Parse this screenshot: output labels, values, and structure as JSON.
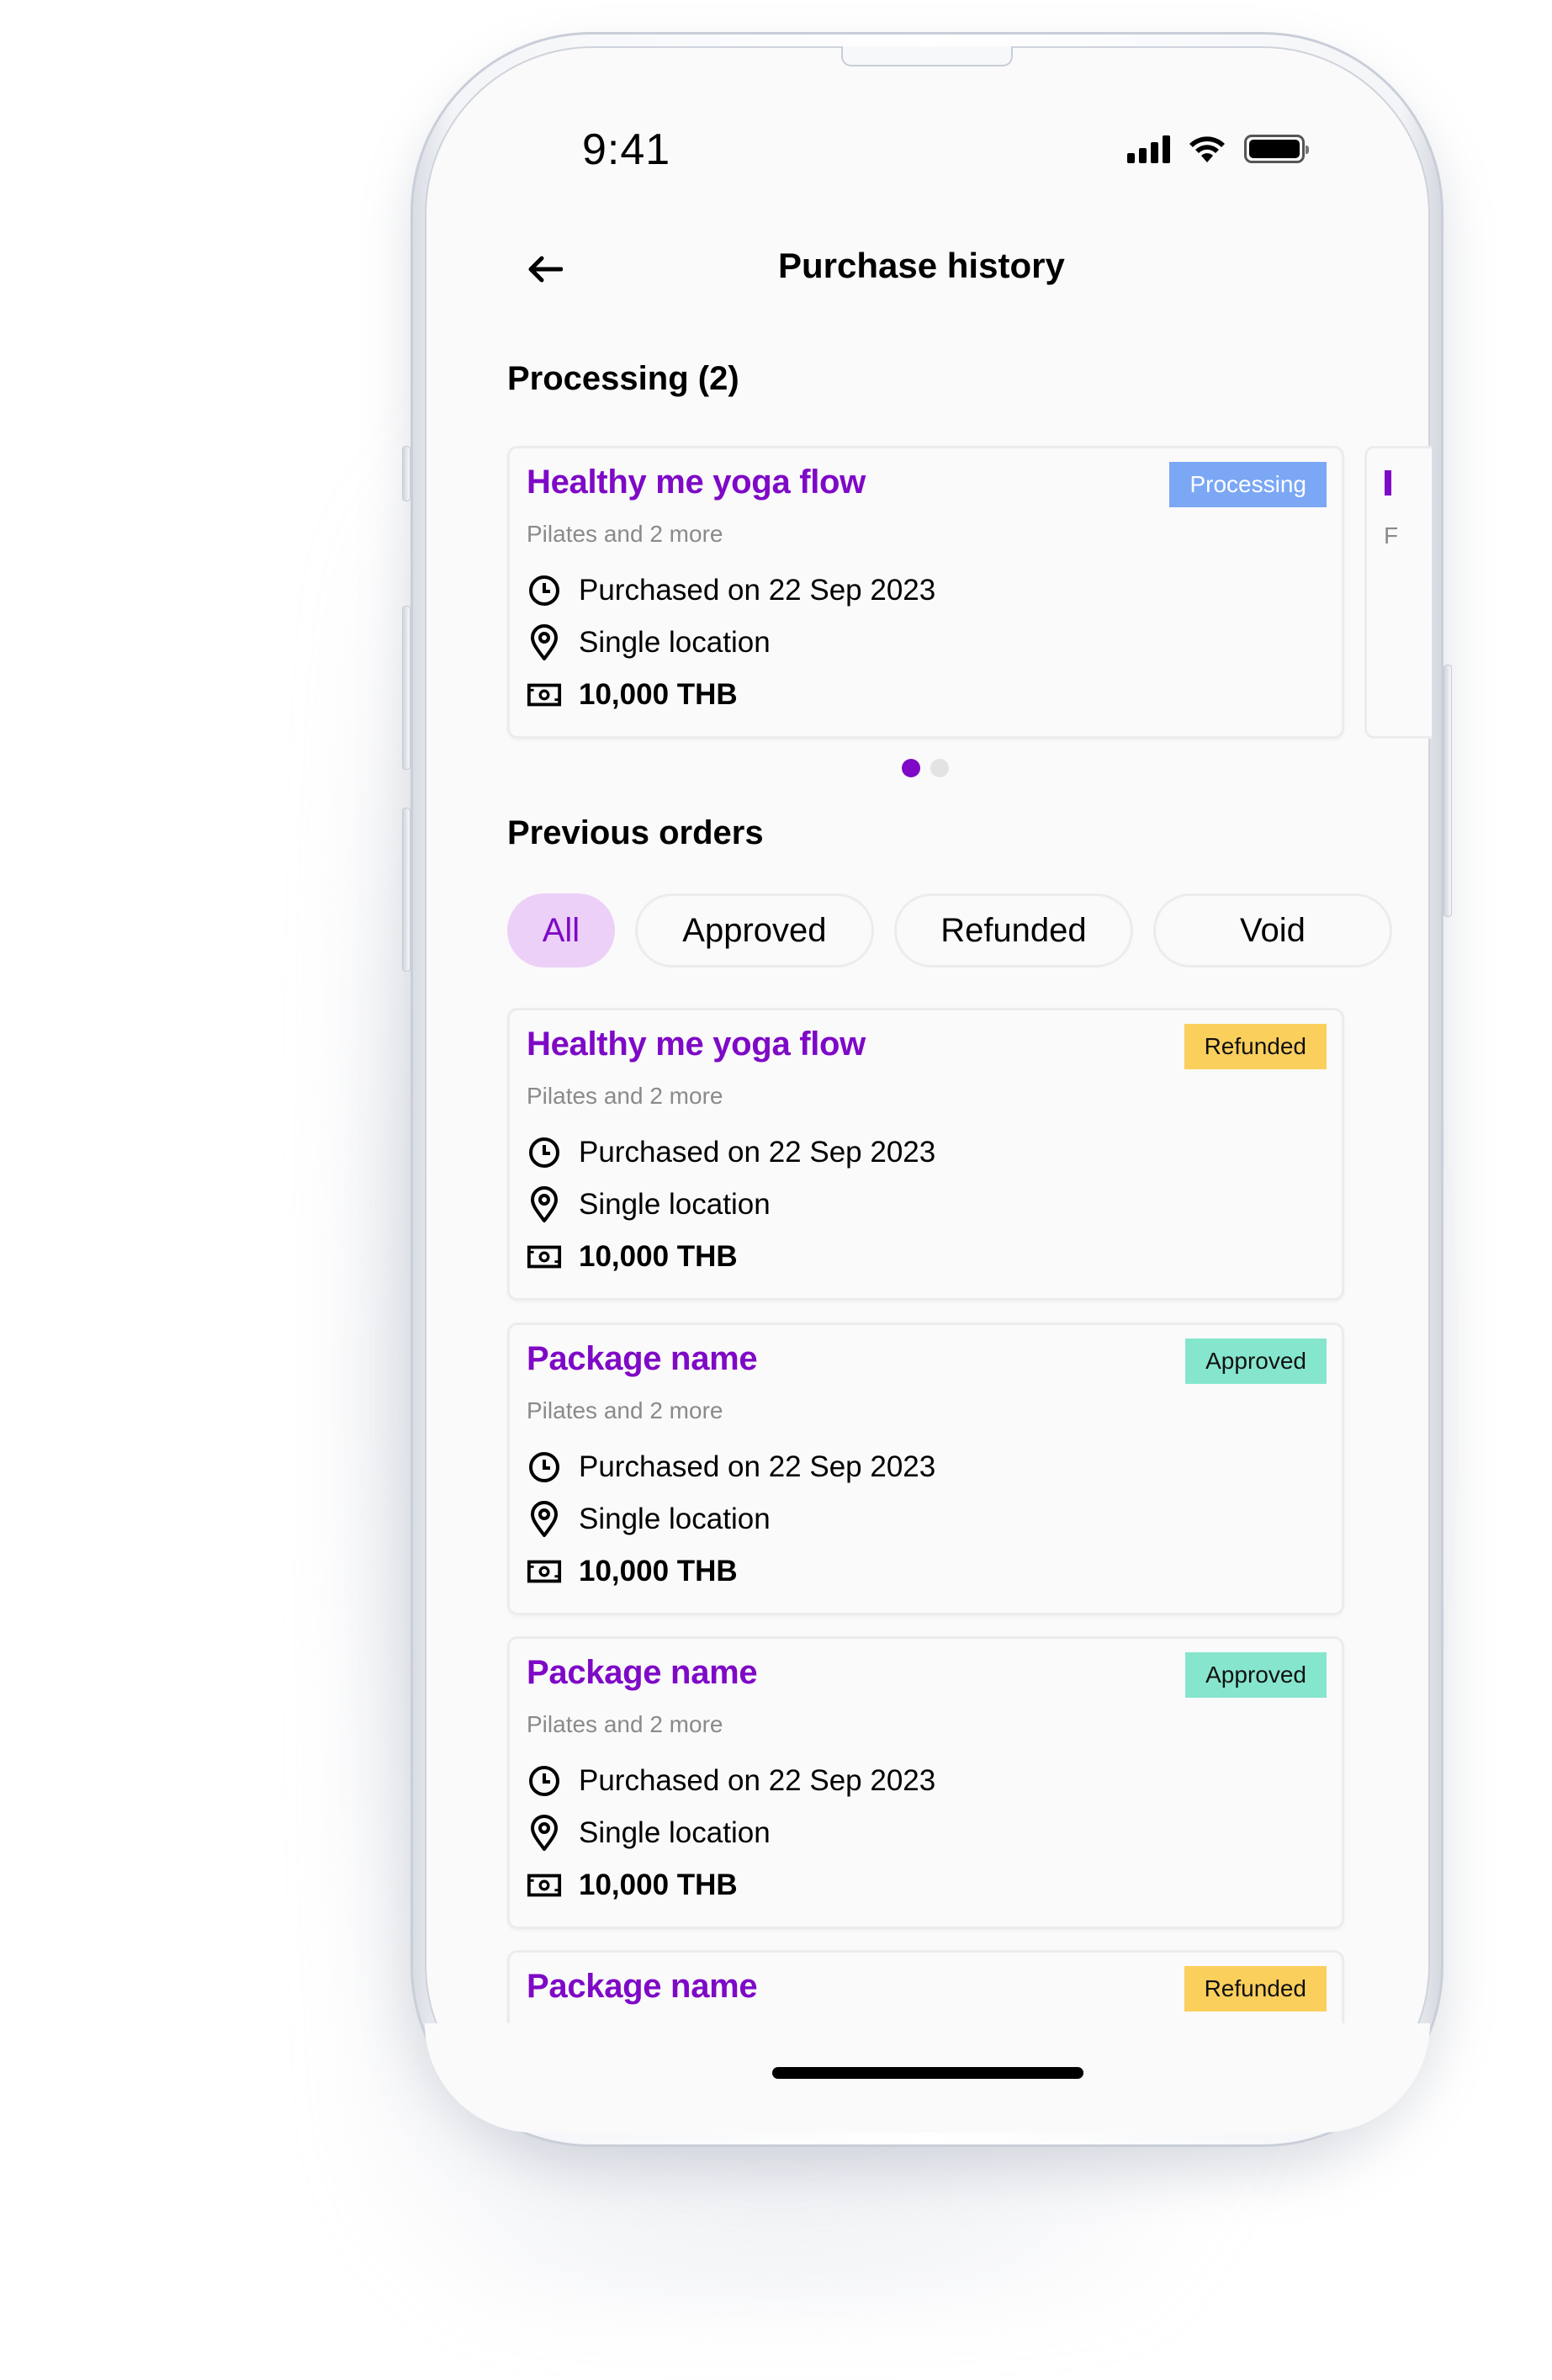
{
  "status_bar": {
    "time": "9:41",
    "icons": [
      "cellular-signal-icon",
      "wifi-icon",
      "battery-icon"
    ]
  },
  "header": {
    "back_icon": "arrow-left-icon",
    "title": "Purchase history"
  },
  "processing": {
    "heading": "Processing (2)",
    "count": 2,
    "carousel_index": 1,
    "carousel_total": 2,
    "cards": [
      {
        "name": "Healthy me yoga flow",
        "subtitle": "Pilates and 2 more",
        "status": "Processing",
        "purchased": "Purchased on 22 Sep 2023",
        "location": "Single location",
        "price": "10,000 THB"
      }
    ]
  },
  "previous_orders": {
    "heading": "Previous orders",
    "filters": [
      {
        "label": "All",
        "active": true
      },
      {
        "label": "Approved",
        "active": false
      },
      {
        "label": "Refunded",
        "active": false
      },
      {
        "label": "Void",
        "active": false
      }
    ],
    "orders": [
      {
        "name": "Healthy me yoga flow",
        "subtitle": "Pilates and 2 more",
        "status": "Refunded",
        "purchased": "Purchased on 22 Sep 2023",
        "location": "Single location",
        "price": "10,000 THB"
      },
      {
        "name": "Package name",
        "subtitle": "Pilates and 2 more",
        "status": "Approved",
        "purchased": "Purchased on 22 Sep 2023",
        "location": "Single location",
        "price": "10,000 THB"
      },
      {
        "name": "Package name",
        "subtitle": "Pilates and 2 more",
        "status": "Approved",
        "purchased": "Purchased on 22 Sep 2023",
        "location": "Single location",
        "price": "10,000 THB"
      },
      {
        "name": "Package name",
        "status": "Refunded"
      }
    ]
  },
  "colors": {
    "accent": "#7e09c6",
    "chip_active_bg": "#ecd0f8",
    "status_processing": "#7ba7f5",
    "status_refunded": "#fbcf5c",
    "status_approved": "#86e6cd",
    "subtitle_text": "#8a8a8a"
  }
}
